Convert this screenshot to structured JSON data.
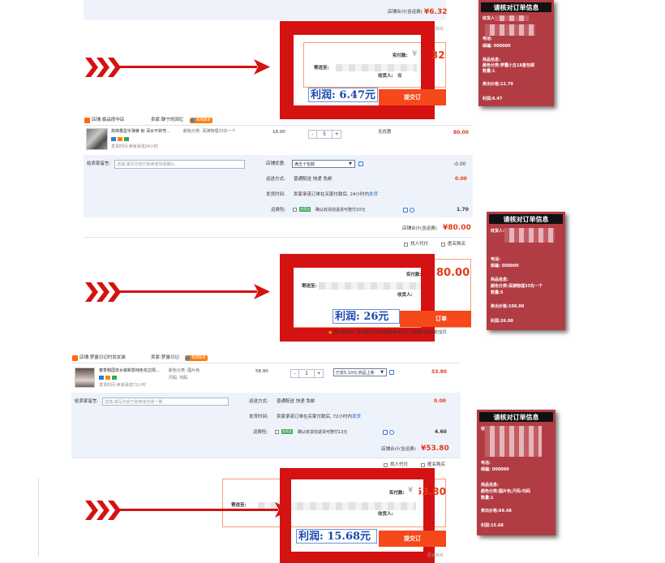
{
  "colors": {
    "accent_red": "#d41212",
    "price_red": "#e23a1a",
    "profit_blue": "#1d46b0",
    "card_bg": "#b23c44",
    "submit_orange": "#f5481b"
  },
  "labels": {
    "shop_total": "店铺合计(含运费)",
    "actual_pay": "实付款:",
    "ship_to": "寄送至:",
    "receiver": "收货人:",
    "receiver2": "收货人:",
    "receiver_name_partial": "报",
    "submit": "提交订单",
    "submit_partial": "提交订",
    "submit_partial2": "订单",
    "message_label": "给卖家留言:",
    "message_placeholder": "选填,填写内容已和卖家协商确认",
    "message_placeholder2": "选填,填写内容已和卖家协商一致",
    "shop_discount": "店铺优惠:",
    "shipping_method": "运送方式:",
    "shipping_value": "普通配送 快递 免邮",
    "ship_time": "发货时间:",
    "ship_time_value_24": "卖家承诺订单在买家付款后, 24小时内",
    "ship_time_value_72": "卖家承诺订单在买家付款后, 72小时内",
    "ship_link": "发货",
    "insurance": "运费险:",
    "insurance_tag": "卖家送",
    "insurance_text_10": "确认收货前退货可赔付10元",
    "insurance_text_13": "确认收货前退货可赔付13元",
    "no_discount": "无优惠",
    "proxy_pay": "找人代付",
    "anonymous": "匿名购买",
    "anon_partial": "匿名购买",
    "warning": "若价格变动, 请在提交订单后联系卖家改价,",
    "warning_tail": "并查看已买到的宝贝",
    "shop_prefix": "店铺:",
    "seller_prefix": "卖家:",
    "contact": "和我联系",
    "seller_promise_24": "卖家承诺24小时",
    "ship_date_label": "发货时间:",
    "promise_72": "卖家承诺72小时"
  },
  "blocks": {
    "b0": {
      "shop_total": "¥6.32",
      "receipt_prefix": "¥",
      "receipt_partial": "6.32",
      "profit": "利润: 6.47元",
      "small_link": "公司采购"
    },
    "b1": {
      "shop_name": "极品撑中店",
      "seller_name": "聊宁的回忆",
      "item_title": "高档量型手弹簧 射 深水不转弯...",
      "item_attr": "颜色分类: 深渊物理33先一个",
      "unit_price": "16.00",
      "qty": "5",
      "item_total": "80.00",
      "discount_select": "满五十包邮",
      "discount_value": "-0.00",
      "ship_value": "0.00",
      "insurance_value": "1.70",
      "shop_total": "¥80.00",
      "actual_pay_amount": "80.00",
      "profit": "利润: 26元"
    },
    "b2": {
      "shop_name": "梦露日记时尚女装",
      "seller_name": "梦露日记",
      "item_title": "春季韩国单女装新款纯色花边领...",
      "item_attr1": "颜色分类: 图片色",
      "item_attr2": "尺码: 均码",
      "unit_price": "58.90",
      "qty": "1",
      "discount_select": "已省5.10元:商品上新",
      "item_total": "53.80",
      "ship_value": "0.00",
      "insurance_value": "4.60",
      "shop_total": "¥53.80",
      "actual_pay_prefix": "¥",
      "actual_pay_amount": "53.80",
      "profit": "利润: 15.68元"
    }
  },
  "cards": [
    {
      "title": "请核对订单信息",
      "lines": [
        "收货人:",
        "电话:",
        "邮编: 000000",
        "商品信息:",
        "颜色分类:梦露小丑18盒包邮",
        "数量:1",
        "卖出价格:12.79",
        "利润:6.47"
      ]
    },
    {
      "title": "请核对订单信息",
      "lines": [
        "收货人:",
        "电话:",
        "邮编: 000000",
        "商品信息:",
        "颜色分类:深渊物理33先一个",
        "数量:5",
        "卖出价格:106.00",
        "利润:26.00"
      ]
    },
    {
      "title": "请核对订单信息",
      "lines": [
        "收货人:",
        "电话:",
        "邮编: 000000",
        "商品信息:",
        "颜色分类:图片色;尺码:均码",
        "数量:1",
        "卖出价格:69.48",
        "利润:15.68"
      ]
    }
  ]
}
